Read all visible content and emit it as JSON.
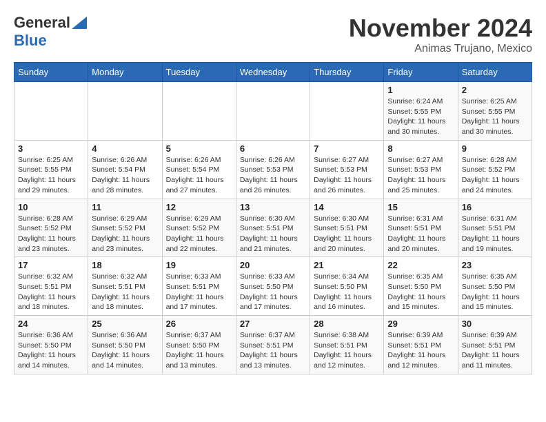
{
  "header": {
    "logo_line1": "General",
    "logo_line2": "Blue",
    "month_title": "November 2024",
    "location": "Animas Trujano, Mexico"
  },
  "days_of_week": [
    "Sunday",
    "Monday",
    "Tuesday",
    "Wednesday",
    "Thursday",
    "Friday",
    "Saturday"
  ],
  "weeks": [
    [
      {
        "day": "",
        "info": ""
      },
      {
        "day": "",
        "info": ""
      },
      {
        "day": "",
        "info": ""
      },
      {
        "day": "",
        "info": ""
      },
      {
        "day": "",
        "info": ""
      },
      {
        "day": "1",
        "info": "Sunrise: 6:24 AM\nSunset: 5:55 PM\nDaylight: 11 hours and 30 minutes."
      },
      {
        "day": "2",
        "info": "Sunrise: 6:25 AM\nSunset: 5:55 PM\nDaylight: 11 hours and 30 minutes."
      }
    ],
    [
      {
        "day": "3",
        "info": "Sunrise: 6:25 AM\nSunset: 5:55 PM\nDaylight: 11 hours and 29 minutes."
      },
      {
        "day": "4",
        "info": "Sunrise: 6:26 AM\nSunset: 5:54 PM\nDaylight: 11 hours and 28 minutes."
      },
      {
        "day": "5",
        "info": "Sunrise: 6:26 AM\nSunset: 5:54 PM\nDaylight: 11 hours and 27 minutes."
      },
      {
        "day": "6",
        "info": "Sunrise: 6:26 AM\nSunset: 5:53 PM\nDaylight: 11 hours and 26 minutes."
      },
      {
        "day": "7",
        "info": "Sunrise: 6:27 AM\nSunset: 5:53 PM\nDaylight: 11 hours and 26 minutes."
      },
      {
        "day": "8",
        "info": "Sunrise: 6:27 AM\nSunset: 5:53 PM\nDaylight: 11 hours and 25 minutes."
      },
      {
        "day": "9",
        "info": "Sunrise: 6:28 AM\nSunset: 5:52 PM\nDaylight: 11 hours and 24 minutes."
      }
    ],
    [
      {
        "day": "10",
        "info": "Sunrise: 6:28 AM\nSunset: 5:52 PM\nDaylight: 11 hours and 23 minutes."
      },
      {
        "day": "11",
        "info": "Sunrise: 6:29 AM\nSunset: 5:52 PM\nDaylight: 11 hours and 23 minutes."
      },
      {
        "day": "12",
        "info": "Sunrise: 6:29 AM\nSunset: 5:52 PM\nDaylight: 11 hours and 22 minutes."
      },
      {
        "day": "13",
        "info": "Sunrise: 6:30 AM\nSunset: 5:51 PM\nDaylight: 11 hours and 21 minutes."
      },
      {
        "day": "14",
        "info": "Sunrise: 6:30 AM\nSunset: 5:51 PM\nDaylight: 11 hours and 20 minutes."
      },
      {
        "day": "15",
        "info": "Sunrise: 6:31 AM\nSunset: 5:51 PM\nDaylight: 11 hours and 20 minutes."
      },
      {
        "day": "16",
        "info": "Sunrise: 6:31 AM\nSunset: 5:51 PM\nDaylight: 11 hours and 19 minutes."
      }
    ],
    [
      {
        "day": "17",
        "info": "Sunrise: 6:32 AM\nSunset: 5:51 PM\nDaylight: 11 hours and 18 minutes."
      },
      {
        "day": "18",
        "info": "Sunrise: 6:32 AM\nSunset: 5:51 PM\nDaylight: 11 hours and 18 minutes."
      },
      {
        "day": "19",
        "info": "Sunrise: 6:33 AM\nSunset: 5:51 PM\nDaylight: 11 hours and 17 minutes."
      },
      {
        "day": "20",
        "info": "Sunrise: 6:33 AM\nSunset: 5:50 PM\nDaylight: 11 hours and 17 minutes."
      },
      {
        "day": "21",
        "info": "Sunrise: 6:34 AM\nSunset: 5:50 PM\nDaylight: 11 hours and 16 minutes."
      },
      {
        "day": "22",
        "info": "Sunrise: 6:35 AM\nSunset: 5:50 PM\nDaylight: 11 hours and 15 minutes."
      },
      {
        "day": "23",
        "info": "Sunrise: 6:35 AM\nSunset: 5:50 PM\nDaylight: 11 hours and 15 minutes."
      }
    ],
    [
      {
        "day": "24",
        "info": "Sunrise: 6:36 AM\nSunset: 5:50 PM\nDaylight: 11 hours and 14 minutes."
      },
      {
        "day": "25",
        "info": "Sunrise: 6:36 AM\nSunset: 5:50 PM\nDaylight: 11 hours and 14 minutes."
      },
      {
        "day": "26",
        "info": "Sunrise: 6:37 AM\nSunset: 5:50 PM\nDaylight: 11 hours and 13 minutes."
      },
      {
        "day": "27",
        "info": "Sunrise: 6:37 AM\nSunset: 5:51 PM\nDaylight: 11 hours and 13 minutes."
      },
      {
        "day": "28",
        "info": "Sunrise: 6:38 AM\nSunset: 5:51 PM\nDaylight: 11 hours and 12 minutes."
      },
      {
        "day": "29",
        "info": "Sunrise: 6:39 AM\nSunset: 5:51 PM\nDaylight: 11 hours and 12 minutes."
      },
      {
        "day": "30",
        "info": "Sunrise: 6:39 AM\nSunset: 5:51 PM\nDaylight: 11 hours and 11 minutes."
      }
    ]
  ]
}
